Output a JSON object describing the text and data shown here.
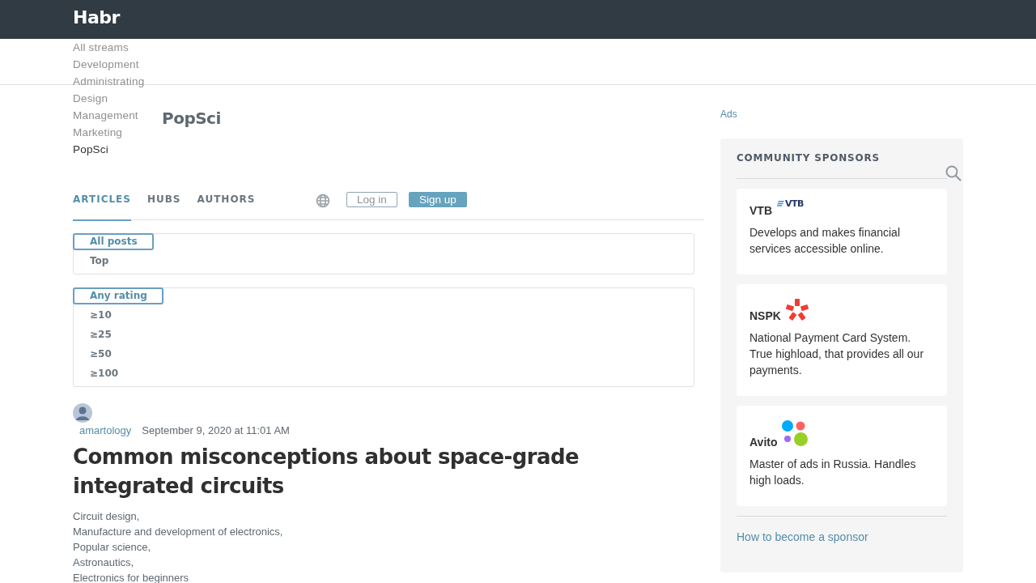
{
  "header": {
    "logo": "Habr",
    "streams": [
      {
        "label": "All streams",
        "selected": false
      },
      {
        "label": "Development",
        "selected": false
      },
      {
        "label": "Administrating",
        "selected": false
      },
      {
        "label": "Design",
        "selected": false
      },
      {
        "label": "Management",
        "selected": false
      },
      {
        "label": "Marketing",
        "selected": false
      },
      {
        "label": "PopSci",
        "selected": true
      }
    ],
    "login": "Log in",
    "signup": "Sign up"
  },
  "page_title": "PopSci",
  "tabs": [
    {
      "label": "ARTICLES",
      "selected": true
    },
    {
      "label": "HUBS",
      "selected": false
    },
    {
      "label": "AUTHORS",
      "selected": false
    }
  ],
  "filters": [
    {
      "items": [
        {
          "label": "All posts",
          "selected": true
        },
        {
          "label": "Top",
          "selected": false
        }
      ]
    },
    {
      "items": [
        {
          "label": "Any rating",
          "selected": true
        },
        {
          "label": "≥10",
          "selected": false
        },
        {
          "label": "≥25",
          "selected": false
        },
        {
          "label": "≥50",
          "selected": false
        },
        {
          "label": "≥100",
          "selected": false
        }
      ]
    }
  ],
  "post": {
    "author": "amartology",
    "date": "September 9, 2020 at 11:01 AM",
    "title": "Common misconceptions about space-grade integrated circuits",
    "hubs": [
      "Circuit design,",
      "Manufacture and development of electronics,",
      "Popular science,",
      "Astronautics,",
      "Electronics for beginners"
    ]
  },
  "sidebar": {
    "ads_label": "Ads",
    "title": "COMMUNITY SPONSORS",
    "sponsors": [
      {
        "name": "VTB",
        "kind": "vtb",
        "logo_text": "VTB",
        "description": "Develops and makes financial services accessible online."
      },
      {
        "name": "NSPK",
        "kind": "nspk",
        "description": "National Payment Card System. True highload, that provides all our payments."
      },
      {
        "name": "Avito",
        "kind": "avito",
        "description": "Master of ads in Russia. Handles high loads."
      }
    ],
    "footer_link": "How to become a sponsor"
  }
}
